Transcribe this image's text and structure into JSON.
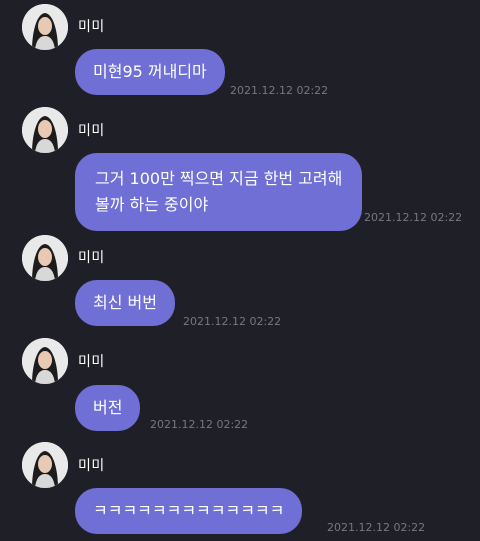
{
  "theme": {
    "background": "#1f1f27",
    "bubble_color": "#6f6fd6",
    "text_color": "#ffffff",
    "timestamp_color": "#77777f"
  },
  "messages": [
    {
      "sender": "미미",
      "lines": [
        "미현95 꺼내디마"
      ],
      "time": "2021.12.12 02:22"
    },
    {
      "sender": "미미",
      "lines": [
        "그거 100만 찍으면 지금 한번 고려해",
        "볼까 하는 중이야"
      ],
      "time": "2021.12.12 02:22"
    },
    {
      "sender": "미미",
      "lines": [
        "최신 버번"
      ],
      "time": "2021.12.12 02:22"
    },
    {
      "sender": "미미",
      "lines": [
        "버전"
      ],
      "time": "2021.12.12 02:22"
    },
    {
      "sender": "미미",
      "lines": [
        "ㅋㅋㅋㅋㅋㅋㅋㅋㅋㅋㅋㅋㅋ"
      ],
      "time": "2021.12.12 02:22"
    }
  ]
}
